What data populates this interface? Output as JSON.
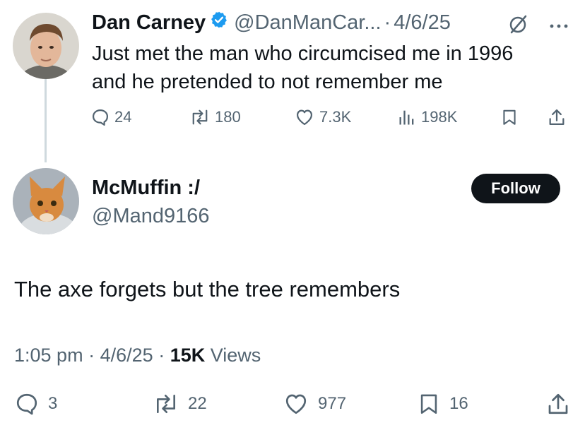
{
  "parent": {
    "display_name": "Dan Carney",
    "handle": "@DanManCar...",
    "separator": "·",
    "date": "4/6/25",
    "text_line1": "Just met the man who circumcised me in 1996",
    "text_line2": "and he pretended to not remember me",
    "actions": {
      "replies": "24",
      "reposts": "180",
      "likes": "7.3K",
      "views": "198K"
    }
  },
  "reply": {
    "display_name": "McMuffin :/",
    "handle": "@Mand9166",
    "follow_label": "Follow",
    "text": "The axe forgets but the tree remembers",
    "time": "1:05 pm",
    "sep1": "·",
    "date": "4/6/25",
    "sep2": "·",
    "views_count": "15K",
    "views_label": "Views",
    "actions": {
      "replies": "3",
      "reposts": "22",
      "likes": "977",
      "bookmarks": "16"
    }
  },
  "colors": {
    "text": "#0f1419",
    "muted": "#536471",
    "verified": "#1d9bf0",
    "follow_bg": "#0f1419",
    "thread_line": "#cfd9de"
  },
  "icons": [
    "verified-badge-icon",
    "grok-icon",
    "more-icon",
    "reply-icon",
    "repost-icon",
    "like-icon",
    "views-icon",
    "bookmark-icon",
    "share-icon"
  ]
}
